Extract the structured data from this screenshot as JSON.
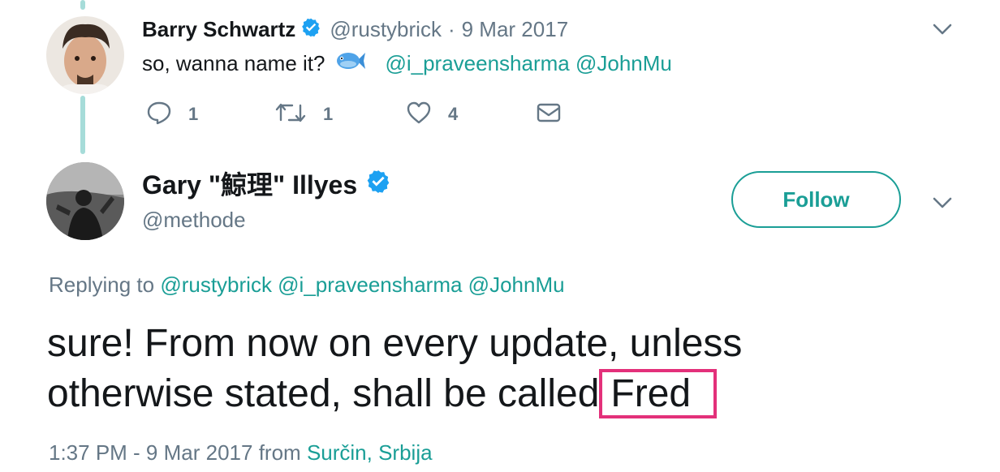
{
  "parent_tweet": {
    "author_name": "Barry Schwartz",
    "handle": "@rustybrick",
    "separator": "·",
    "date": "9 Mar 2017",
    "text": "so, wanna name it?",
    "emoji": "🐟",
    "mentions": "@i_praveensharma @JohnMu",
    "reply_count": "1",
    "retweet_count": "1",
    "like_count": "4"
  },
  "main_tweet": {
    "author_name": "Gary \"鯨理\" Illyes",
    "handle": "@methode",
    "follow_label": "Follow",
    "replying_prefix": "Replying to",
    "replying_to": "@rustybrick @i_praveensharma @JohnMu",
    "text_main": "sure! From now on every update, unless otherwise stated, shall be called",
    "highlighted_word": "Fred",
    "timestamp": "1:37 PM - 9 Mar 2017",
    "from_label": "from",
    "location": "Surčin, Srbija"
  },
  "colors": {
    "accent": "#1a9e96",
    "thread_line": "#a6dcd9",
    "muted": "#657786",
    "highlight_box": "#e3307a",
    "verified": "#1da1f2"
  },
  "icons": [
    "verified-badge-icon",
    "chevron-down-icon",
    "reply-icon",
    "retweet-icon",
    "like-icon",
    "direct-message-icon"
  ]
}
